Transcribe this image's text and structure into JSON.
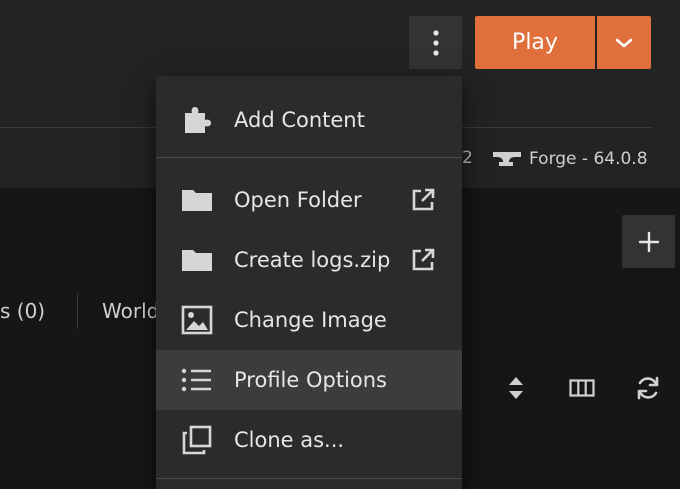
{
  "header": {
    "play_label": "Play",
    "meta_fragment": "2",
    "loader": "Forge - 64.0.8"
  },
  "tabs": {
    "mods": "s (0)",
    "worlds": "World"
  },
  "menu": {
    "items": [
      {
        "label": "Add Content",
        "icon": "puzzle-icon"
      },
      {
        "label": "Open Folder",
        "icon": "folder-icon",
        "external": true
      },
      {
        "label": "Create logs.zip",
        "icon": "folder-icon",
        "external": true
      },
      {
        "label": "Change Image",
        "icon": "image-icon"
      },
      {
        "label": "Profile Options",
        "icon": "list-icon",
        "active": true
      },
      {
        "label": "Clone as...",
        "icon": "clone-icon"
      }
    ]
  },
  "toolbar_icons": [
    "sort-icon",
    "columns-icon",
    "refresh-icon"
  ],
  "colors": {
    "accent": "#e0703b",
    "background": "#161616",
    "panel": "#232323",
    "menu": "#2b2b2b",
    "menu_active": "#3c3c3c"
  }
}
